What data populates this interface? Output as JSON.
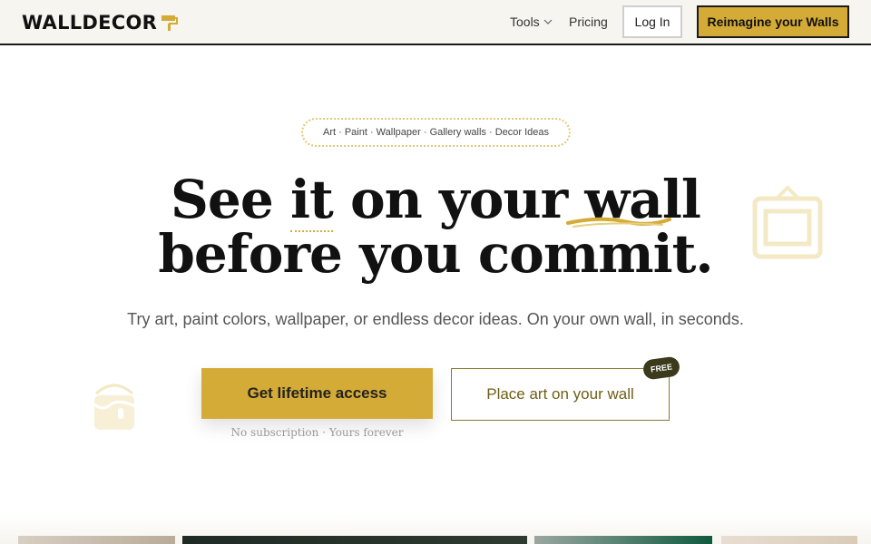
{
  "header": {
    "logo_text": "WALLDECOR",
    "logo_icon": "paint-roller-icon",
    "nav": {
      "tools": "Tools",
      "pricing": "Pricing"
    },
    "login_label": "Log In",
    "cta_label": "Reimagine your Walls"
  },
  "hero": {
    "pill": "Art · Paint · Wallpaper · Gallery walls · Decor Ideas",
    "headline_line1": {
      "w1": "See",
      "w2": "it",
      "w3": "on your",
      "w4": "wall"
    },
    "headline_line2": "before you commit.",
    "subhead": "Try art, paint colors, wallpaper, or endless decor ideas. On your own wall, in seconds.",
    "primary_cta": "Get lifetime access",
    "secondary_cta": "Place art on your wall",
    "badge": "FREE",
    "fineprint": "No subscription · Yours forever"
  },
  "colors": {
    "accent": "#d4ab36",
    "accent_dark": "#6f5e16",
    "header_bg": "#f7f5f0",
    "text": "#1a1a1a"
  }
}
